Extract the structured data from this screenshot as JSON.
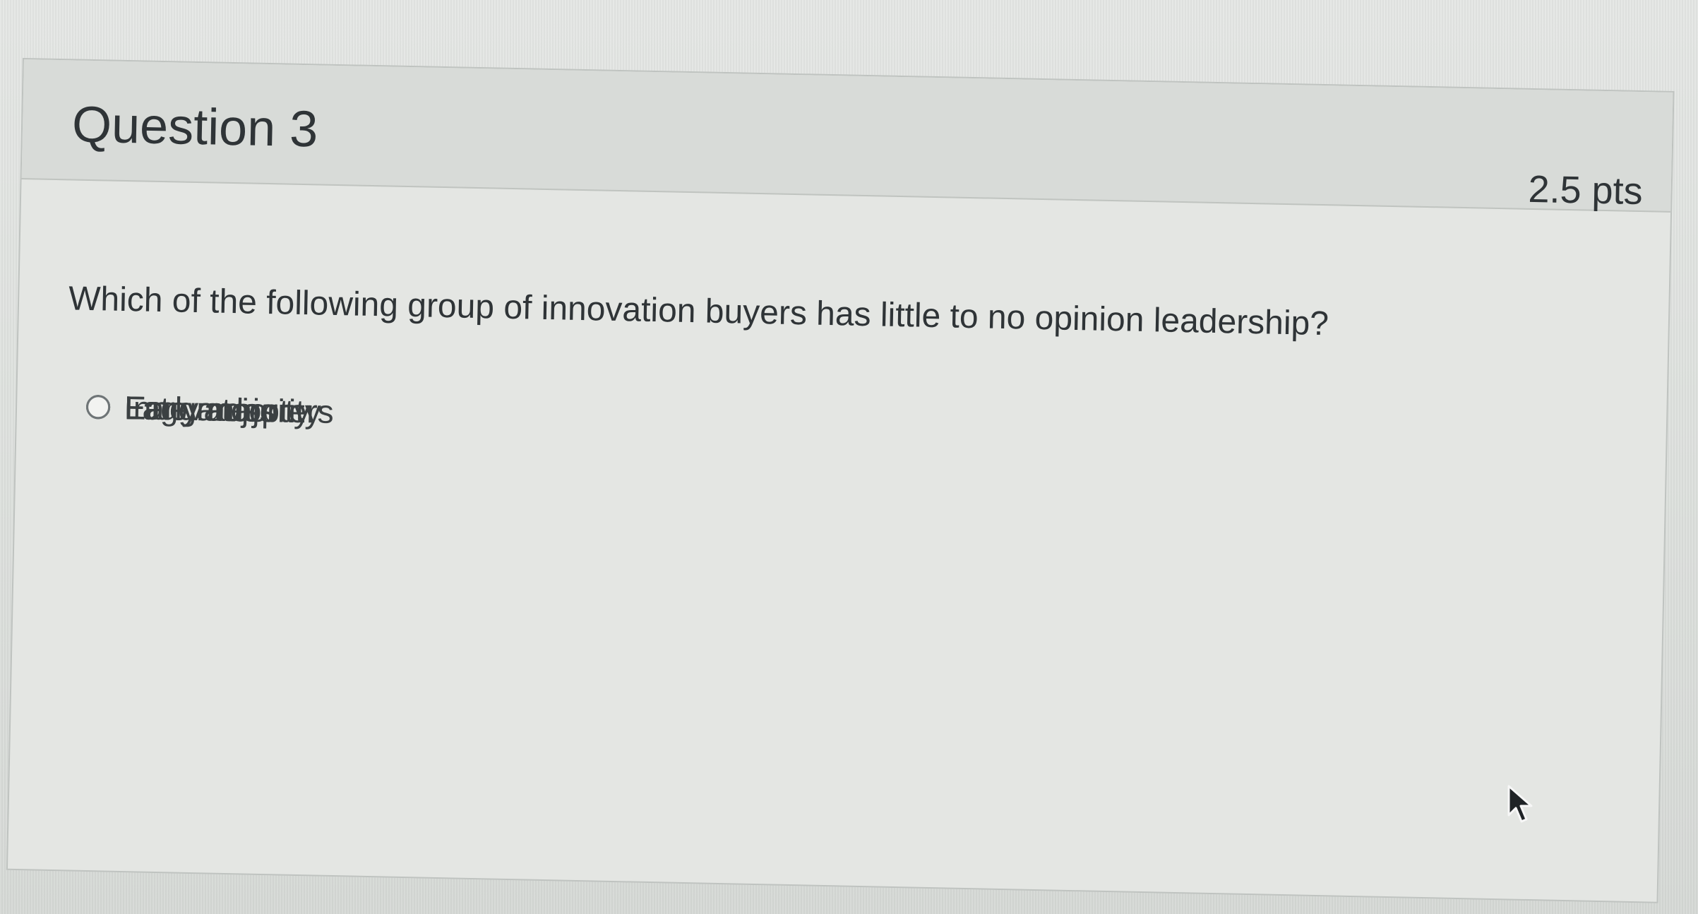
{
  "question": {
    "title": "Question 3",
    "points": "2.5 pts",
    "text": "Which of the following group of innovation buyers has little to no opinion leadership?",
    "answers": [
      {
        "label": "Late majority"
      },
      {
        "label": "Innovators"
      },
      {
        "label": "Early majority"
      },
      {
        "label": "Laggards"
      },
      {
        "label": "Early adopters"
      }
    ]
  },
  "cursor": {
    "icon": "mouse-pointer-icon"
  }
}
